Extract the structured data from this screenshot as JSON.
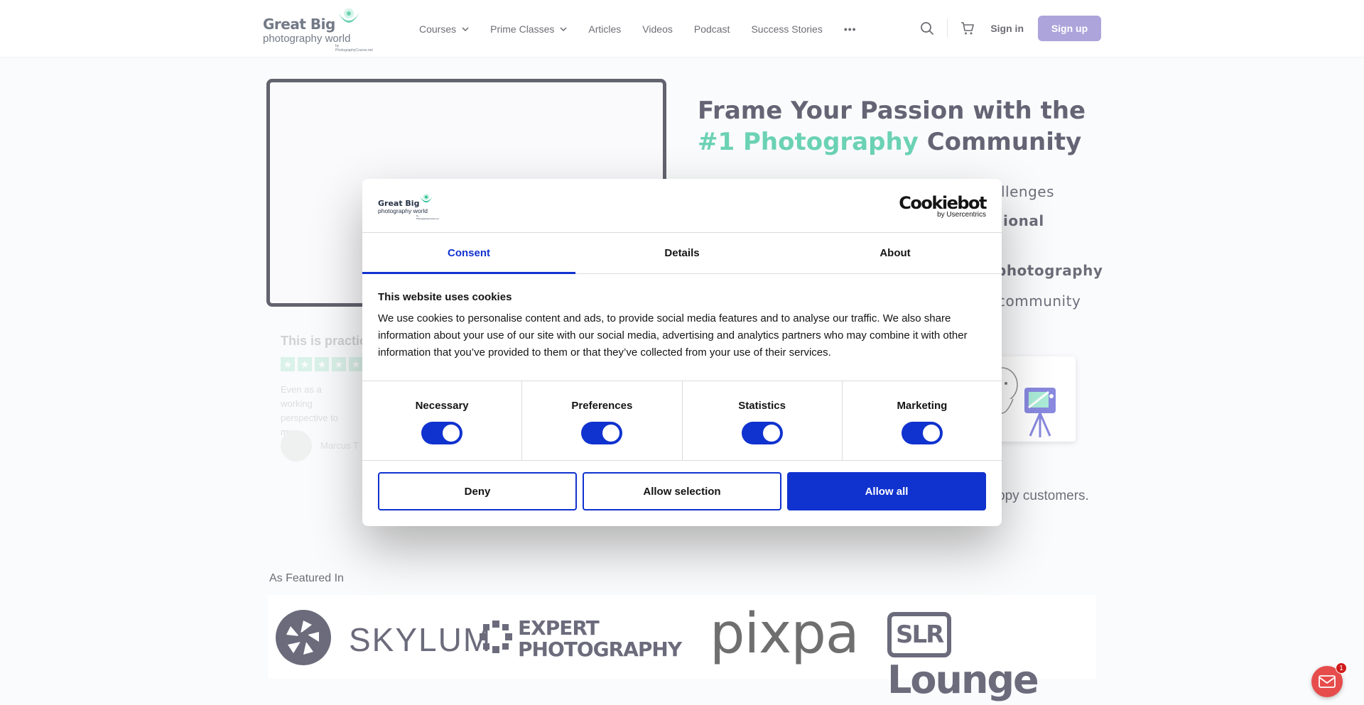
{
  "header": {
    "logo": {
      "line1": "Great Big",
      "line2": "photography world",
      "line3": "by PhotographyCourse.net"
    },
    "nav": [
      {
        "label": "Courses",
        "has_dropdown": true
      },
      {
        "label": "Prime Classes",
        "has_dropdown": true
      },
      {
        "label": "Articles",
        "has_dropdown": false
      },
      {
        "label": "Videos",
        "has_dropdown": false
      },
      {
        "label": "Podcast",
        "has_dropdown": false
      },
      {
        "label": "Success Stories",
        "has_dropdown": false
      }
    ],
    "more_label": "•••",
    "search_icon": "search-icon",
    "cart_icon": "cart-icon",
    "signin_label": "Sign in",
    "signup_label": "Sign up",
    "signup_color": "#8074c6"
  },
  "hero": {
    "title_line1": "Frame Your Passion with the",
    "title_accent": "#1 Photography",
    "title_rest": "Community",
    "accent_color": "#1dbb8d",
    "visible_lines": [
      "llenges",
      "ional",
      "photography",
      "community"
    ],
    "happy_text": "ppy customers.",
    "testimonial": {
      "title": "This is practic",
      "body": "Even as a working perspective to my",
      "author": "Marcus T"
    }
  },
  "featured": {
    "label": "As Featured In",
    "logos": [
      "SKYLUM",
      "EXPERT PHOTOGRAPHY",
      "pixpa",
      "SLR Lounge"
    ],
    "expert_line1": "EXPERT",
    "expert_line2": "PHOTOGRAPHY",
    "slr_box": "SLR",
    "slr_rest": "Lounge"
  },
  "cookie_dialog": {
    "logo": {
      "line1": "Great Big",
      "line2": "photography world",
      "line3": "by PhotographyCourse.net"
    },
    "provider": "Cookiebot",
    "provider_sub": "by Usercentrics",
    "tabs": [
      {
        "label": "Consent",
        "active": true
      },
      {
        "label": "Details",
        "active": false
      },
      {
        "label": "About",
        "active": false
      }
    ],
    "title": "This website uses cookies",
    "text": "We use cookies to personalise content and ads, to provide social media features and to analyse our traffic. We also share information about your use of our site with our social media, advertising and analytics partners who may combine it with other information that you’ve provided to them or that they’ve collected from your use of their services.",
    "categories": [
      {
        "label": "Necessary",
        "enabled": true
      },
      {
        "label": "Preferences",
        "enabled": true
      },
      {
        "label": "Statistics",
        "enabled": true
      },
      {
        "label": "Marketing",
        "enabled": true
      }
    ],
    "buttons": {
      "deny": "Deny",
      "allow_selection": "Allow selection",
      "allow_all": "Allow all"
    },
    "accent_color": "#1032cf"
  },
  "chat_widget": {
    "icon": "envelope-icon",
    "badge_count": "1"
  }
}
